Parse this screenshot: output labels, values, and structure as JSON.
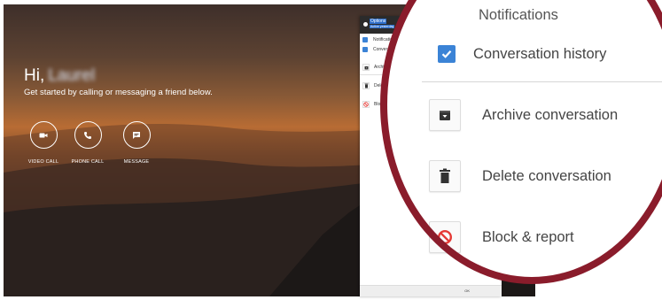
{
  "greeting": {
    "hi": "Hi,",
    "name": "Laurel",
    "subtitle": "Get started by calling or messaging a friend below."
  },
  "actions": [
    {
      "label": "VIDEO CALL",
      "icon": "video-camera-icon"
    },
    {
      "label": "PHONE CALL",
      "icon": "phone-icon"
    },
    {
      "label": "MESSAGE",
      "icon": "chat-bubble-icon"
    }
  ],
  "options_panel": {
    "title": "Options",
    "subtitle": "Active yesterday",
    "toggles": [
      {
        "label": "Notifications",
        "checked": true
      },
      {
        "label": "Conversation history",
        "checked": true
      }
    ],
    "menu": [
      {
        "label": "Archive conversation",
        "icon": "archive-icon"
      },
      {
        "label": "Delete conversation",
        "icon": "trash-icon"
      },
      {
        "label": "Block & report",
        "icon": "block-icon"
      }
    ],
    "ok_label": "OK",
    "visible_menu_labels": [
      "Archive conv",
      "Delete co",
      "Block"
    ]
  },
  "colors": {
    "accent": "#3b83d6",
    "block_red": "#e53935",
    "magnifier_ring": "#8a1c2b",
    "panel_header": "#2b2b2b"
  }
}
